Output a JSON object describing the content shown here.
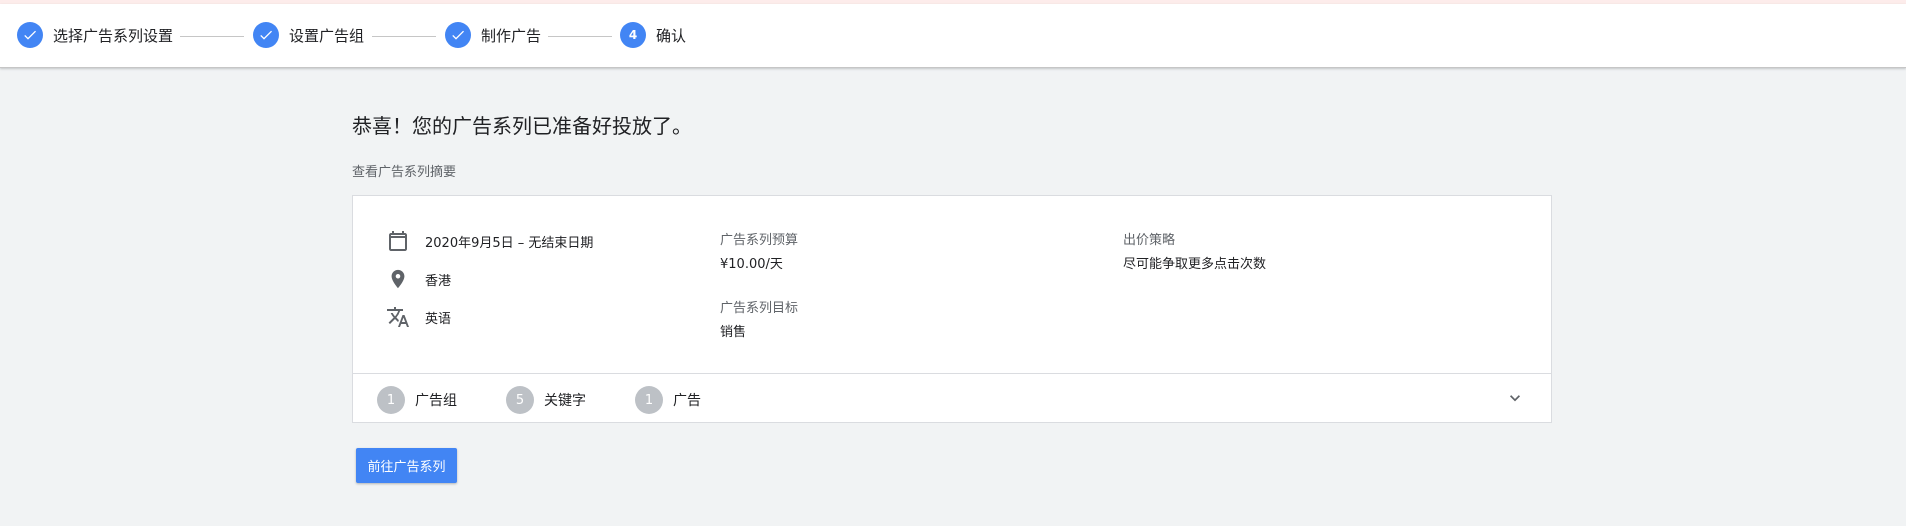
{
  "stepper": {
    "steps": [
      {
        "label": "选择广告系列设置",
        "state": "done",
        "icon": "check-icon"
      },
      {
        "label": "设置广告组",
        "state": "done",
        "icon": "check-icon"
      },
      {
        "label": "制作广告",
        "state": "done",
        "icon": "check-icon"
      },
      {
        "label": "确认",
        "state": "current",
        "number": "4"
      }
    ],
    "accent": "#4285f4"
  },
  "main": {
    "title": "恭喜！您的广告系列已准备好投放了。",
    "subtitle": "查看广告系列摘要"
  },
  "summary": {
    "dates": {
      "icon": "calendar-icon",
      "text": "2020年9月5日 – 无结束日期"
    },
    "location": {
      "icon": "location-pin-icon",
      "text": "香港"
    },
    "language": {
      "icon": "translate-icon",
      "text": "英语"
    },
    "budget": {
      "label": "广告系列预算",
      "value": "¥10.00/天"
    },
    "goal": {
      "label": "广告系列目标",
      "value": "销售"
    },
    "bidding": {
      "label": "出价策略",
      "value": "尽可能争取更多点击次数"
    }
  },
  "counts": [
    {
      "count": "1",
      "label": "广告组"
    },
    {
      "count": "5",
      "label": "关键字"
    },
    {
      "count": "1",
      "label": "广告"
    }
  ],
  "actions": {
    "go_to_campaigns": "前往广告系列"
  }
}
